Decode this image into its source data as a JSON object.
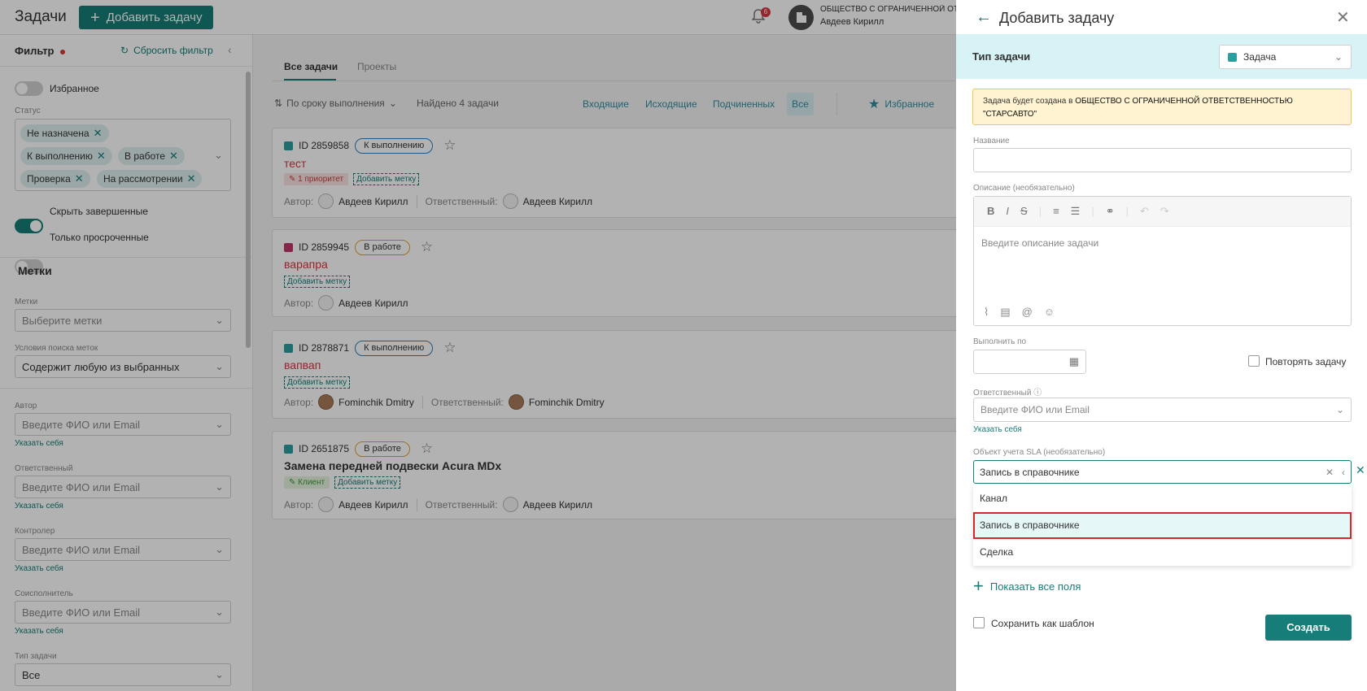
{
  "header": {
    "title": "Задачи",
    "add_button": "Добавить задачу",
    "notifications_count": "6",
    "org_name": "ОБЩЕСТВО С ОГРАНИЧЕННОЙ ОТВЕТСТВЕННОСТЬЮ \"СТАРСАВТО\"",
    "user_name": "Авдеев Кирилл"
  },
  "sidebar": {
    "filter_title": "Фильтр",
    "reset_filter": "Сбросить фильтр",
    "favorites_toggle": "Избранное",
    "status_label": "Статус",
    "status_chips": [
      "Не назначена",
      "К выполнению",
      "В работе",
      "Проверка",
      "На рассмотрении"
    ],
    "hide_completed": "Скрыть завершенные",
    "only_overdue": "Только просроченные",
    "tags_section": "Метки",
    "tags_label": "Метки",
    "tags_placeholder": "Выберите метки",
    "tag_search_label": "Условия поиска меток",
    "tag_search_value": "Содержит любую из выбранных",
    "author_label": "Автор",
    "responsible_label": "Ответственный",
    "controller_label": "Контролер",
    "coexecutor_label": "Соисполнитель",
    "person_placeholder": "Введите ФИО или Email",
    "set_self": "Указать себя",
    "task_type_label": "Тип задачи",
    "task_type_value": "Все"
  },
  "main": {
    "tabs": [
      "Все задачи",
      "Проекты"
    ],
    "sort_label": "По сроку выполнения",
    "found": "Найдено 4 задачи",
    "filter_tabs": [
      "Входящие",
      "Исходящие",
      "Подчиненных",
      "Все"
    ],
    "favorites": "Избранное",
    "author_prefix": "Автор:",
    "responsible_prefix": "Ответственный:",
    "add_tag": "Добавить метку",
    "tasks": [
      {
        "id": "ID 2859858",
        "status": "К выполнению",
        "title": "тест",
        "priority": "1 приоритет",
        "author": "Авдеев Кирилл",
        "responsible": "Авдеев Кирилл"
      },
      {
        "id": "ID 2859945",
        "status": "В работе",
        "title": "варапра",
        "author": "Авдеев Кирилл"
      },
      {
        "id": "ID 2878871",
        "status": "К выполнению",
        "title": "вапвап",
        "author": "Fominchik Dmitry",
        "responsible": "Fominchik Dmitry"
      },
      {
        "id": "ID 2651875",
        "status": "В работе",
        "title": "Замена передней подвески Acura MDx",
        "tag": "Клиент",
        "author": "Авдеев Кирилл",
        "responsible": "Авдеев Кирилл"
      }
    ]
  },
  "modal": {
    "title": "Добавить задачу",
    "task_type_label": "Тип задачи",
    "task_type_value": "Задача",
    "notice_prefix": "Задача будет создана в ",
    "notice_org": "ОБЩЕСТВО С ОГРАНИЧЕННОЙ ОТВЕТСТВЕННОСТЬЮ \"СТАРСАВТО\"",
    "name_label": "Название",
    "desc_label": "Описание (необязательно)",
    "desc_placeholder": "Введите описание задачи",
    "due_label": "Выполнить по",
    "repeat_label": "Повторять задачу",
    "responsible_label": "Ответственный",
    "responsible_placeholder": "Введите ФИО или Email",
    "set_self": "Указать себя",
    "sla_label": "Объект учета SLA (необязательно)",
    "sla_value": "Запись в справочнике",
    "sla_options": [
      "Канал",
      "Запись в справочнике",
      "Сделка"
    ],
    "sla_selected_index": 1,
    "show_all_fields": "Показать все поля",
    "save_template": "Сохранить как шаблон",
    "create": "Создать"
  },
  "colors": {
    "accent": "#167d78",
    "highlight": "#d9262b"
  }
}
